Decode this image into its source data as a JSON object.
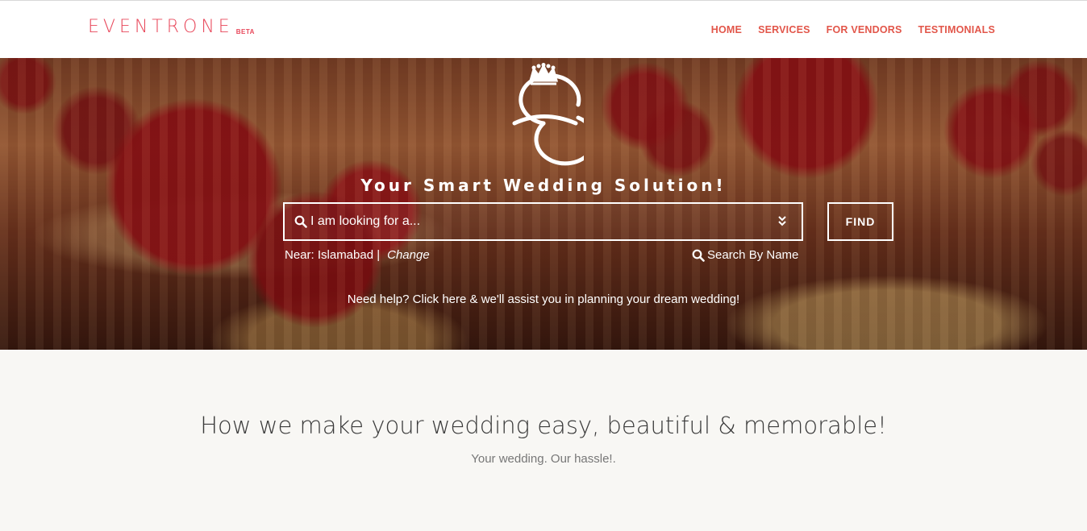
{
  "header": {
    "logo": "EVENTRONE",
    "beta": "BETA",
    "nav": [
      "HOME",
      "SERVICES",
      "FOR VENDORS",
      "TESTIMONIALS"
    ]
  },
  "hero": {
    "tagline": "Your Smart Wedding Solution!",
    "search_placeholder": "I am looking for a...",
    "find_label": "FIND",
    "near_label": "Near: Islamabad |",
    "change_label": "Change",
    "search_by_name": "Search By Name",
    "help_text": "Need help? Click here & we'll assist you in planning your dream wedding!"
  },
  "section": {
    "title": "How we make your wedding easy, beautiful & memorable!",
    "subtitle": "Your wedding. Our hassle!."
  },
  "colors": {
    "brand": "#e8475a",
    "nav": "#e2564a"
  }
}
